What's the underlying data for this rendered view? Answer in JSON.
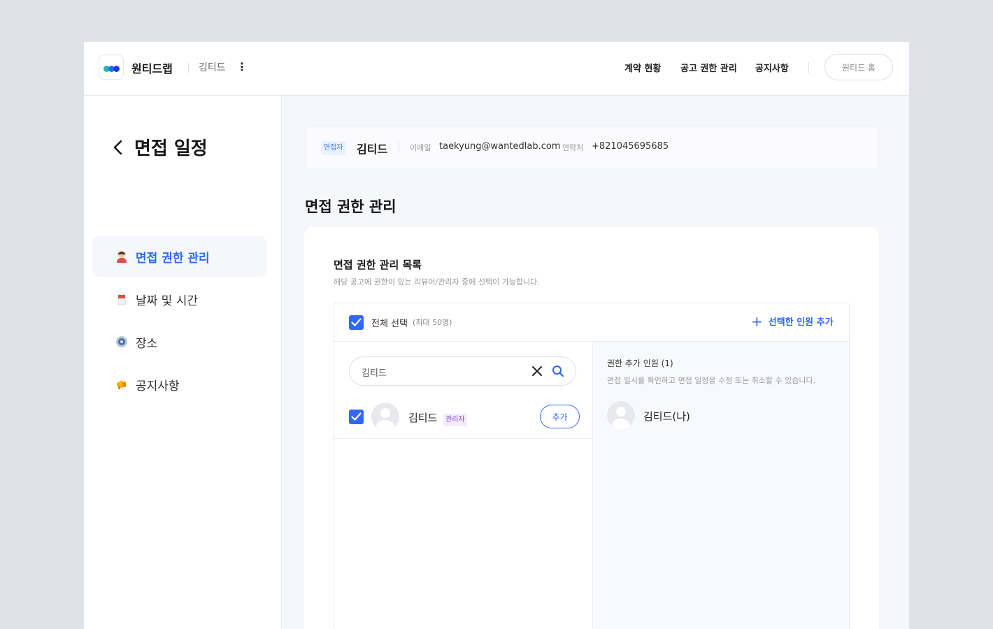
{
  "header": {
    "company": "원티드랩",
    "user_name": "김티드",
    "nav": [
      "계약 현황",
      "공고 권한 관리",
      "공지사항"
    ],
    "home_button": "원티드 홈",
    "logo_colors": [
      "#2bb6b0",
      "#1f6ff5",
      "#1f3ce0"
    ]
  },
  "sidebar": {
    "title": "면접 일정",
    "items": [
      {
        "label": "면접 권한 관리",
        "icon": "person-icon",
        "active": true
      },
      {
        "label": "날짜 및 시간",
        "icon": "calendar-icon",
        "active": false
      },
      {
        "label": "장소",
        "icon": "location-icon",
        "active": false
      },
      {
        "label": "공지사항",
        "icon": "megaphone-icon",
        "active": false
      }
    ]
  },
  "candidate": {
    "badge": "면접자",
    "name": "김티드",
    "email_label": "이메일",
    "email": "taekyung@wantedlab.com",
    "phone_label": "연락처",
    "phone": "+821045695685"
  },
  "main": {
    "section_title": "면접 권한 관리",
    "panel_title": "면접 권한 관리 목록",
    "panel_desc": "해당 공고에 권한이 있는 리뷰어/관리자 중에 선택이 가능합니다.",
    "select_all": "전체 선택",
    "select_all_note": "(최대 50명)",
    "add_selected": "선택한 인원 추가",
    "search_value": "김티드",
    "results": [
      {
        "name": "김티드",
        "role": "관리자",
        "action": "추가",
        "checked": true
      }
    ],
    "added_title": "권한 추가 인원 (1)",
    "added_desc": "면접 일시를 확인하고 면접 일정을 수정 또는 취소할 수 있습니다.",
    "added": [
      {
        "name": "김티드(나)"
      }
    ]
  },
  "colors": {
    "accent": "#3366ff",
    "active_menu": "#2e6bf0",
    "role_badge": "#8a4bd8"
  }
}
